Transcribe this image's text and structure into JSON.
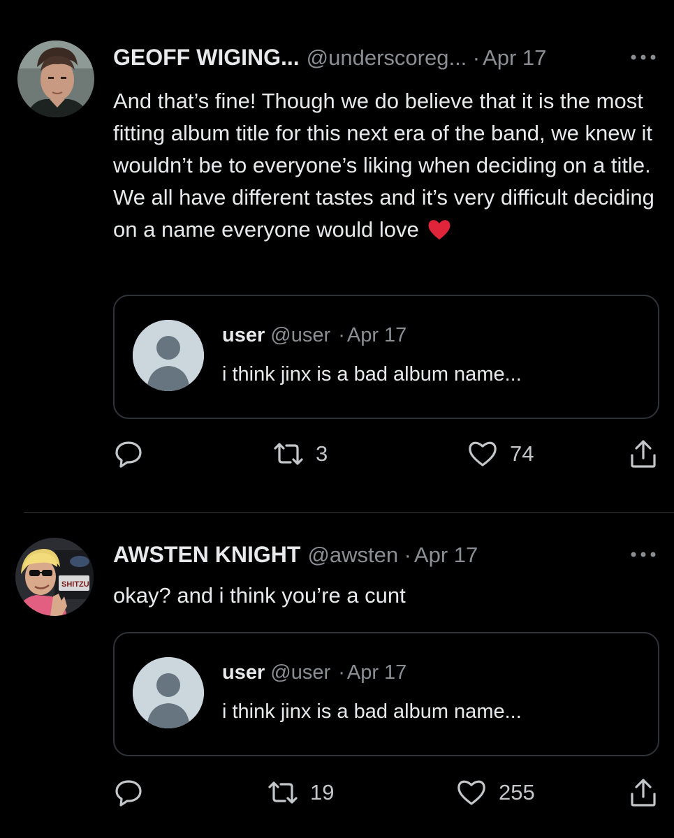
{
  "tweets": [
    {
      "name": "GEOFF WIGING...",
      "handle": "@underscoreg...",
      "separator": "·",
      "time": "Apr 17",
      "text": "And that’s fine! Though we do believe that it is the most fitting album title for this next era of the band, we knew it wouldn’t be to everyone’s liking when deciding on a title. We all have different tastes and it’s very difficult deciding on a name everyone would love",
      "emoji": "red-heart",
      "quote": {
        "name": "user",
        "handle": "@user",
        "separator": "·",
        "time": "Apr 17",
        "text": "i think jinx is a bad album name..."
      },
      "actions": {
        "replies": "",
        "retweets": "3",
        "likes": "74"
      }
    },
    {
      "name": "AWSTEN KNIGHT",
      "handle": "@awsten",
      "separator": "·",
      "time": "Apr 17",
      "text": "okay? and i think you’re a cunt",
      "quote": {
        "name": "user",
        "handle": "@user",
        "separator": "·",
        "time": "Apr 17",
        "text": "i think jinx is a bad album name..."
      },
      "actions": {
        "replies": "",
        "retweets": "19",
        "likes": "255"
      }
    }
  ],
  "colors": {
    "background": "#000000",
    "text": "#e7e9ea",
    "secondary_text": "#8b8f94",
    "border": "#2f3336",
    "heart_emoji": "#e0243a"
  },
  "icons": [
    "more-icon",
    "reply-icon",
    "retweet-icon",
    "like-icon",
    "share-icon",
    "default-avatar-icon"
  ]
}
